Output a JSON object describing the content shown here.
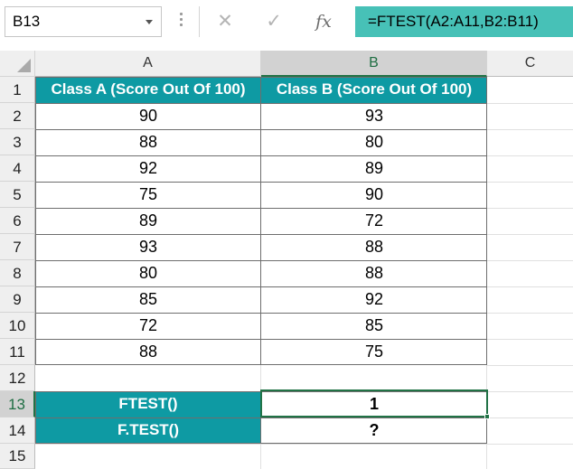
{
  "name_box": {
    "value": "B13"
  },
  "formula_bar": {
    "cancel_glyph": "✕",
    "enter_glyph": "✓",
    "fx_label": "fx",
    "formula": "=FTEST(A2:A11,B2:B11)"
  },
  "grid": {
    "columns": [
      "A",
      "B",
      "C"
    ],
    "selected_column": "B",
    "rows": [
      "1",
      "2",
      "3",
      "4",
      "5",
      "6",
      "7",
      "8",
      "9",
      "10",
      "11",
      "12",
      "13",
      "14",
      "15"
    ],
    "selected_row": "13",
    "header_row": {
      "a": "Class A (Score Out Of 100)",
      "b": "Class B (Score Out Of 100)"
    },
    "data_rows": [
      {
        "a": "90",
        "b": "93"
      },
      {
        "a": "88",
        "b": "80"
      },
      {
        "a": "92",
        "b": "89"
      },
      {
        "a": "75",
        "b": "90"
      },
      {
        "a": "89",
        "b": "72"
      },
      {
        "a": "93",
        "b": "88"
      },
      {
        "a": "80",
        "b": "88"
      },
      {
        "a": "85",
        "b": "92"
      },
      {
        "a": "72",
        "b": "85"
      },
      {
        "a": "88",
        "b": "75"
      }
    ],
    "results": [
      {
        "label": "FTEST()",
        "value": "1"
      },
      {
        "label": "F.TEST()",
        "value": "?"
      }
    ]
  },
  "colors": {
    "header_fill": "#0e9aa3",
    "formula_highlight": "#47c1b7",
    "selection": "#217346"
  }
}
